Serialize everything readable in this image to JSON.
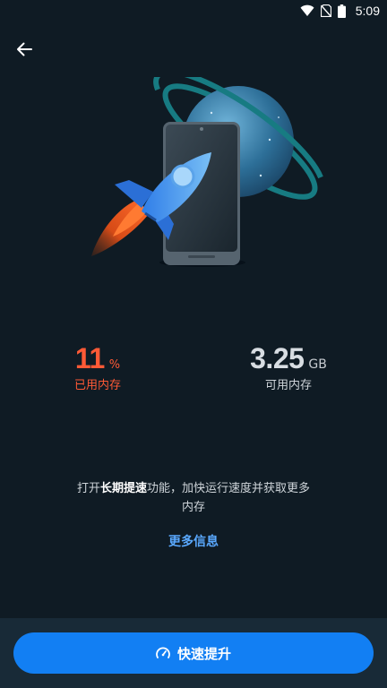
{
  "status_bar": {
    "time": "5:09",
    "icons": [
      "wifi-icon",
      "no-sim-icon",
      "battery-icon"
    ]
  },
  "header": {
    "back_icon": "arrow-left-icon"
  },
  "hero": {
    "illustration": [
      "planet-icon",
      "phone-icon",
      "rocket-icon"
    ]
  },
  "memory": {
    "used_value": "11",
    "used_unit": "%",
    "used_label": "已用内存",
    "free_value": "3.25",
    "free_unit": "GB",
    "free_label": "可用内存"
  },
  "description": {
    "prefix": "打开",
    "highlight": "长期提速",
    "suffix_line1": "功能，加快运行速度并获取更多",
    "suffix_line2": "内存"
  },
  "more_info_label": "更多信息",
  "boost_button": {
    "label": "快速提升",
    "icon": "speedometer-icon"
  },
  "colors": {
    "background": "#0f1b24",
    "accent": "#127ff3",
    "used": "#ff5a36",
    "link": "#5aa9ff"
  }
}
